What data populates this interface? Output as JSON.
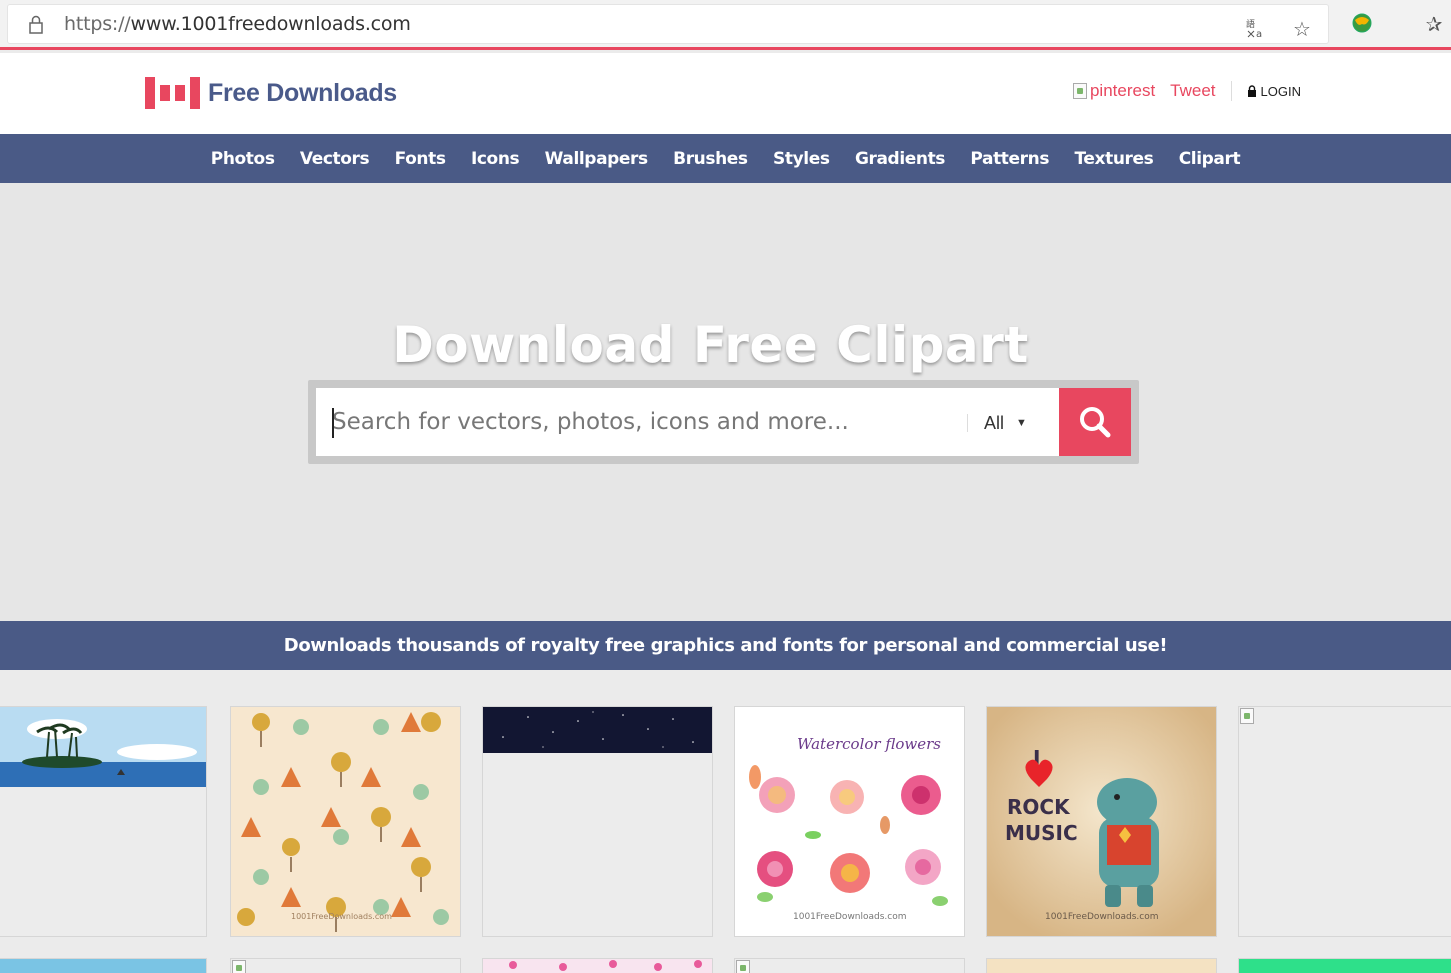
{
  "browser": {
    "url_scheme": "https://",
    "url_host": "www.1001freedownloads.com",
    "icons": [
      "lock-icon",
      "translate-icon",
      "star-icon",
      "extension-globe-icon",
      "favorites-icon"
    ]
  },
  "header": {
    "logo_text": "Free Downloads",
    "pinterest_alt": "pinterest",
    "tweet_label": "Tweet",
    "login_label": "LOGIN"
  },
  "nav": {
    "items": [
      "Photos",
      "Vectors",
      "Fonts",
      "Icons",
      "Wallpapers",
      "Brushes",
      "Styles",
      "Gradients",
      "Patterns",
      "Textures",
      "Clipart"
    ]
  },
  "hero": {
    "title": "Download Free Clipart",
    "search_placeholder": "Search for vectors, photos, icons and more...",
    "category_value": "All"
  },
  "banner": {
    "text": "Downloads thousands of royalty free graphics and fonts for personal and commercial use!"
  },
  "gallery": {
    "watermark": "1001FreeDownloads.com",
    "card3_title": "Watercolor flowers",
    "card4_line1": "I",
    "card4_line2": "ROCK",
    "card4_line3": "MUSIC"
  },
  "colors": {
    "accent": "#e8475f",
    "nav_bg": "#4a5a86",
    "logo_text": "#4a5a8a",
    "hero_bg": "#e6e6e6"
  }
}
